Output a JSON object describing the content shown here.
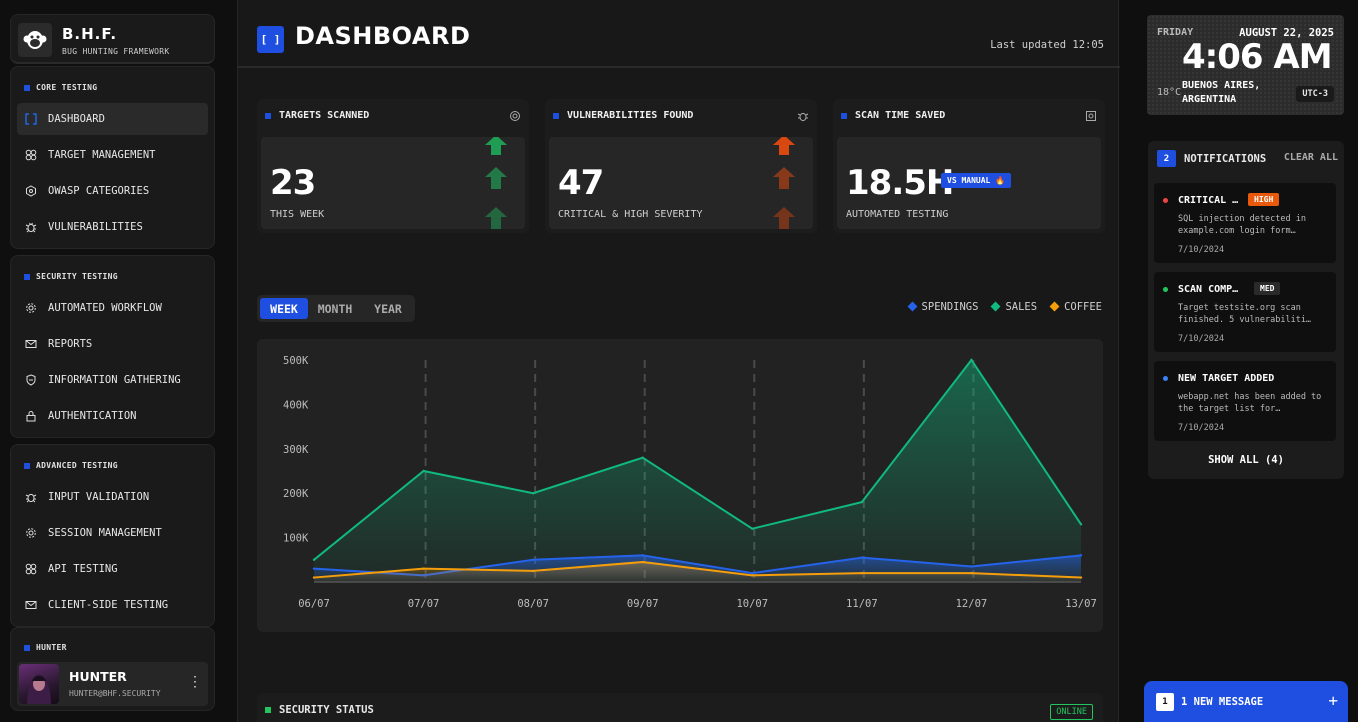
{
  "brand": {
    "title": "B.H.F.",
    "subtitle": "BUG HUNTING FRAMEWORK"
  },
  "sidebar": {
    "sections": [
      {
        "title": "CORE TESTING",
        "items": [
          {
            "label": "DASHBOARD",
            "icon": "brackets-icon",
            "active": true
          },
          {
            "label": "TARGET MANAGEMENT",
            "icon": "target-icon"
          },
          {
            "label": "OWASP CATEGORIES",
            "icon": "hexagon-icon"
          },
          {
            "label": "VULNERABILITIES",
            "icon": "bug-icon"
          }
        ]
      },
      {
        "title": "SECURITY TESTING",
        "items": [
          {
            "label": "AUTOMATED WORKFLOW",
            "icon": "gear-icon"
          },
          {
            "label": "REPORTS",
            "icon": "mail-icon"
          },
          {
            "label": "INFORMATION GATHERING",
            "icon": "shield-icon"
          },
          {
            "label": "AUTHENTICATION",
            "icon": "lock-icon"
          }
        ]
      },
      {
        "title": "ADVANCED TESTING",
        "items": [
          {
            "label": "INPUT VALIDATION",
            "icon": "bug-icon"
          },
          {
            "label": "SESSION MANAGEMENT",
            "icon": "gear-icon"
          },
          {
            "label": "API TESTING",
            "icon": "target-icon"
          },
          {
            "label": "CLIENT-SIDE TESTING",
            "icon": "mail-icon"
          }
        ]
      }
    ],
    "user": {
      "section": "HUNTER",
      "name": "HUNTER",
      "email": "HUNTER@BHF.SECURITY",
      "menu": "⋮"
    }
  },
  "header": {
    "icon": "[ ]",
    "title": "DASHBOARD",
    "updated": "Last updated 12:05"
  },
  "cards": [
    {
      "title": "TARGETS SCANNED",
      "value": "23",
      "label": "THIS WEEK",
      "icon": "target-icon",
      "arrow_color": "#1f9d55"
    },
    {
      "title": "VULNERABILITIES FOUND",
      "value": "47",
      "label": "CRITICAL & HIGH SEVERITY",
      "icon": "bug-icon",
      "arrow_color": "#d9480f"
    },
    {
      "title": "SCAN TIME SAVED",
      "value": "18.5H",
      "label": "AUTOMATED TESTING",
      "icon": "clock-icon",
      "badge": "VS MANUAL 🔥"
    }
  ],
  "tabs": {
    "week": "WEEK",
    "month": "MONTH",
    "year": "YEAR",
    "active": "WEEK"
  },
  "chart_data": {
    "type": "area",
    "x": [
      "06/07",
      "07/07",
      "08/07",
      "09/07",
      "10/07",
      "11/07",
      "12/07",
      "13/07"
    ],
    "y_ticks": [
      "500K",
      "400K",
      "300K",
      "200K",
      "100K"
    ],
    "ylim": [
      0,
      500000
    ],
    "grid": "vertical dashed",
    "legend": "top-right",
    "series": [
      {
        "name": "SALES",
        "color": "#10b981",
        "values": [
          50000,
          250000,
          200000,
          280000,
          120000,
          180000,
          500000,
          130000
        ]
      },
      {
        "name": "SPENDINGS",
        "color": "#2563eb",
        "values": [
          30000,
          15000,
          50000,
          60000,
          20000,
          55000,
          35000,
          60000
        ]
      },
      {
        "name": "COFFEE",
        "color": "#f59e0b",
        "values": [
          10000,
          30000,
          25000,
          45000,
          15000,
          20000,
          20000,
          10000
        ]
      }
    ]
  },
  "legend": [
    {
      "name": "SPENDINGS",
      "color": "#2563eb"
    },
    {
      "name": "SALES",
      "color": "#10b981"
    },
    {
      "name": "COFFEE",
      "color": "#f59e0b"
    }
  ],
  "status": {
    "title": "SECURITY STATUS",
    "badge": "ONLINE"
  },
  "clock": {
    "day": "FRIDAY",
    "date": "AUGUST 22, 2025",
    "time": "4:06 AM",
    "temp": "18°C",
    "location": "BUENOS AIRES, ARGENTINA",
    "tz": "UTC-3"
  },
  "notifications": {
    "count": "2",
    "title": "NOTIFICATIONS",
    "clear": "CLEAR ALL",
    "show_all": "SHOW ALL (4)",
    "items": [
      {
        "title": "CRITICAL …",
        "tag": "HIGH",
        "tag_color": "#e8590c",
        "dot": "#ef4444",
        "body": "SQL injection detected in example.com login form…",
        "date": "7/10/2024"
      },
      {
        "title": "SCAN COMP…",
        "tag": "MED",
        "tag_color": "#2a2a2a",
        "dot": "#22c55e",
        "body": "Target testsite.org scan finished. 5 vulnerabiliti…",
        "date": "7/10/2024"
      },
      {
        "title": "NEW TARGET ADDED",
        "tag": "",
        "dot": "#3b82f6",
        "body": "webapp.net has been added to the target list for…",
        "date": "7/10/2024"
      }
    ]
  },
  "message": {
    "count": "1",
    "label": "1 NEW MESSAGE",
    "plus": "+"
  }
}
